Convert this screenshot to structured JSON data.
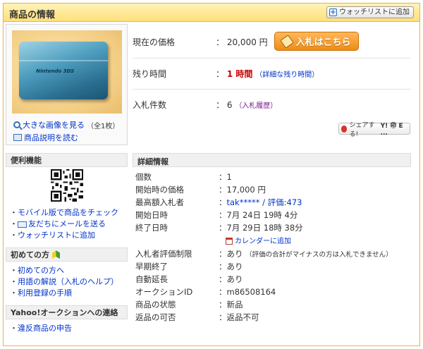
{
  "header": {
    "title": "商品の情報",
    "watchlist_button": "ウォッチリストに追加"
  },
  "image_area": {
    "device_text": "Nintendo 3DS",
    "zoom_link": "大きな画像を見る",
    "zoom_count": "（全1枚）",
    "description_link": "商品説明を読む"
  },
  "summary": {
    "price": {
      "label": "現在の価格",
      "colon": "：",
      "value": "20,000 円"
    },
    "bid_button": "入札はこちら",
    "time_left": {
      "label": "残り時間",
      "colon": "：",
      "value": "1 時間",
      "detail_link": "（詳細な残り時間）"
    },
    "bids": {
      "label": "入札件数",
      "colon": "：",
      "value": "6",
      "history_link": "（入札履歴）"
    },
    "share_button": {
      "label": "シェアする!",
      "services": "Y! ㊞ E ..."
    }
  },
  "sidebar": {
    "convenience": {
      "title": "便利機能",
      "items": [
        "モバイル版で商品をチェック",
        "友だちにメールを送る",
        "ウォッチリストに追加"
      ]
    },
    "first_time": {
      "title": "初めての方",
      "items": [
        "初めての方へ",
        "用語の解説（入札のヘルプ）",
        "利用登録の手順"
      ]
    },
    "contact": {
      "title": "Yahoo!オークションへの連絡",
      "items": [
        "違反商品の申告"
      ]
    }
  },
  "details": {
    "title": "詳細情報",
    "colon": "：",
    "rows": [
      {
        "label": "個数",
        "value": "1"
      },
      {
        "label": "開始時の価格",
        "value": "17,000 円"
      },
      {
        "label": "最高額入札者",
        "value": "tak***** / 評価:473"
      },
      {
        "label": "開始日時",
        "value": "7月 24日 19時 4分"
      },
      {
        "label": "終了日時",
        "value": "7月 29日 18時 38分"
      },
      {
        "label": "入札者評価制限",
        "value": "あり",
        "note": "（評価の合計がマイナスの方は入札できません）"
      },
      {
        "label": "早期終了",
        "value": "あり"
      },
      {
        "label": "自動延長",
        "value": "あり"
      },
      {
        "label": "オークションID",
        "value": "m86508164"
      },
      {
        "label": "商品の状態",
        "value": "新品"
      },
      {
        "label": "返品の可否",
        "value": "返品不可"
      }
    ],
    "calendar_link": "カレンダーに追加"
  },
  "colors": {
    "header_bg": "#ffe07a",
    "accent_red": "#cc0000",
    "bid_button": "#f08c12",
    "link": "#0033cc"
  }
}
